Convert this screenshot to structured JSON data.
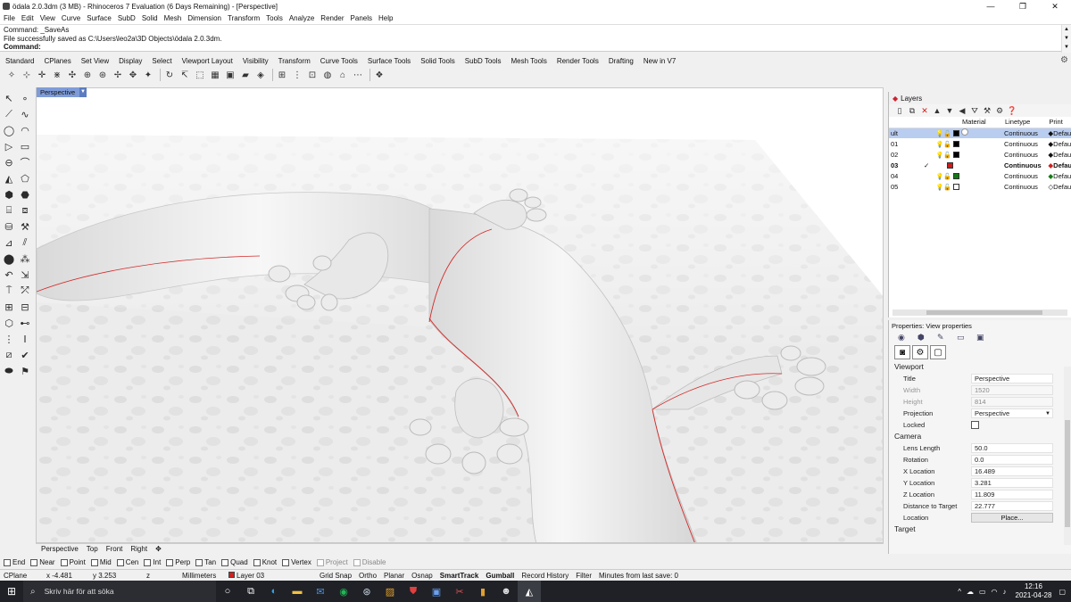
{
  "title_bar": {
    "title": "ödala 2.0.3dm (3 MB) - Rhinoceros 7 Evaluation (6 Days Remaining) - [Perspective]",
    "minimize": "—",
    "maximize": "❐",
    "close": "✕"
  },
  "menu": [
    "File",
    "Edit",
    "View",
    "Curve",
    "Surface",
    "SubD",
    "Solid",
    "Mesh",
    "Dimension",
    "Transform",
    "Tools",
    "Analyze",
    "Render",
    "Panels",
    "Help"
  ],
  "command_history": [
    "Command: _SaveAs",
    "File successfully saved as C:\\Users\\leo2a\\3D Objects\\ödala 2.0.3dm."
  ],
  "command_prompt": "Command:",
  "toolbar_tabs": [
    "Standard",
    "CPlanes",
    "Set View",
    "Display",
    "Select",
    "Viewport Layout",
    "Visibility",
    "Transform",
    "Curve Tools",
    "Surface Tools",
    "Solid Tools",
    "SubD Tools",
    "Mesh Tools",
    "Render Tools",
    "Drafting",
    "New in V7"
  ],
  "toolbar_icons": [
    "new-file-icon",
    "open-icon",
    "save-icon",
    "print-icon",
    "import-icon",
    "export-icon",
    "cut-icon",
    "copy-icon",
    "paste-icon",
    "undo-icon",
    "redo-icon",
    "pan-icon",
    "rotate-view-icon",
    "zoom-icon",
    "zoom-extents-icon",
    "zoom-window-icon",
    "zoom-selected-icon",
    "four-view-icon",
    "grid-icon",
    "select-all-icon",
    "layer-icon",
    "properties-icon",
    "render-icon",
    "help-icon"
  ],
  "viewport": {
    "name": "Perspective"
  },
  "viewport_tabs": [
    "Perspective",
    "Top",
    "Front",
    "Right",
    "✥"
  ],
  "osnaps": [
    {
      "label": "End",
      "disabled": false
    },
    {
      "label": "Near",
      "disabled": false
    },
    {
      "label": "Point",
      "disabled": false
    },
    {
      "label": "Mid",
      "disabled": false
    },
    {
      "label": "Cen",
      "disabled": false
    },
    {
      "label": "Int",
      "disabled": false
    },
    {
      "label": "Perp",
      "disabled": false
    },
    {
      "label": "Tan",
      "disabled": false
    },
    {
      "label": "Quad",
      "disabled": false
    },
    {
      "label": "Knot",
      "disabled": false
    },
    {
      "label": "Vertex",
      "disabled": false
    },
    {
      "label": "Project",
      "disabled": true
    },
    {
      "label": "Disable",
      "disabled": true
    }
  ],
  "status": {
    "cplane": "CPlane",
    "x": "x -4.481",
    "y": "y 3.253",
    "z": "z",
    "units": "Millimeters",
    "layer": "Layer 03",
    "toggles": [
      "Grid Snap",
      "Ortho",
      "Planar",
      "Osnap",
      "SmartTrack",
      "Gumball",
      "Record History",
      "Filter"
    ],
    "save_info": "Minutes from last save: 0"
  },
  "layers": {
    "panel_title": "Layers",
    "columns": [
      "",
      "",
      "",
      "Material",
      "Linetype",
      "Print"
    ],
    "rows": [
      {
        "name": "ult",
        "current": false,
        "selected": true,
        "color": "#000000",
        "linetype": "Continuous",
        "print": "Defau"
      },
      {
        "name": "01",
        "current": false,
        "selected": false,
        "color": "#000000",
        "linetype": "Continuous",
        "print": "Defau"
      },
      {
        "name": "02",
        "current": false,
        "selected": false,
        "color": "#000000",
        "linetype": "Continuous",
        "print": "Defau"
      },
      {
        "name": "03",
        "current": true,
        "selected": false,
        "color": "#cc1b1b",
        "linetype": "Continuous",
        "print": "Defau"
      },
      {
        "name": "04",
        "current": false,
        "selected": false,
        "color": "#147a14",
        "linetype": "Continuous",
        "print": "Defau"
      },
      {
        "name": "05",
        "current": false,
        "selected": false,
        "color": "#ffffff",
        "linetype": "Continuous",
        "print": "Defau"
      }
    ],
    "check_mark": "✓"
  },
  "properties": {
    "panel_title": "Properties: View properties",
    "viewport_section": "Viewport",
    "viewport_fields": [
      {
        "label": "Title",
        "value": "Perspective",
        "dim": false
      },
      {
        "label": "Width",
        "value": "1520",
        "dim": true
      },
      {
        "label": "Height",
        "value": "814",
        "dim": true
      },
      {
        "label": "Projection",
        "value": "Perspective",
        "dim": false
      },
      {
        "label": "Locked",
        "value": "",
        "dim": false
      }
    ],
    "camera_section": "Camera",
    "camera_fields": [
      {
        "label": "Lens Length",
        "value": "50.0",
        "dim": false
      },
      {
        "label": "Rotation",
        "value": "0.0",
        "dim": false
      },
      {
        "label": "X Location",
        "value": "16.489",
        "dim": false
      },
      {
        "label": "Y Location",
        "value": "3.281",
        "dim": false
      },
      {
        "label": "Z Location",
        "value": "11.809",
        "dim": false
      },
      {
        "label": "Distance to Target",
        "value": "22.777",
        "dim": false
      }
    ],
    "location_label": "Location",
    "place_button": "Place...",
    "target_section": "Target"
  },
  "taskbar": {
    "search_placeholder": "Skriv här för att söka",
    "time": "12:16",
    "date": "2021-04-28",
    "apps": [
      "task-view-icon",
      "edge-icon",
      "file-explorer-icon",
      "mail-icon",
      "spotify-icon",
      "steam-icon",
      "app-icon",
      "shield-app-icon",
      "photo-app-icon",
      "snip-app-icon",
      "office-icon",
      "user-app-icon",
      "rhino-icon"
    ]
  },
  "colors": {
    "accent": "#7f9cd8",
    "seam_red": "#d42a2a",
    "taskbar": "#1f2126"
  }
}
